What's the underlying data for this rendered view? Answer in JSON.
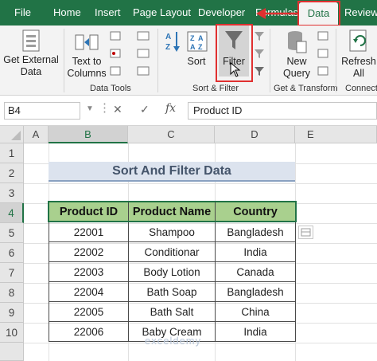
{
  "tabs": [
    "File",
    "Home",
    "Insert",
    "Page Layout",
    "Developer",
    "Formulas",
    "Data",
    "Review"
  ],
  "active_tab": "Data",
  "ribbon": {
    "get_external_data": [
      "Get External",
      "Data"
    ],
    "text_to_columns": [
      "Text to",
      "Columns"
    ],
    "sort": "Sort",
    "filter": "Filter",
    "new_query": [
      "New",
      "Query"
    ],
    "refresh_all": [
      "Refresh",
      "All"
    ],
    "groups": [
      "Data Tools",
      "Sort & Filter",
      "Get & Transform",
      "Connecti"
    ]
  },
  "formula_bar": {
    "name_box": "B4",
    "cancel": "✕",
    "enter": "✓",
    "fx": "fx",
    "value": "Product ID"
  },
  "columns": [
    "A",
    "B",
    "C",
    "D",
    "E"
  ],
  "rows": [
    "1",
    "2",
    "3",
    "4",
    "5",
    "6",
    "7",
    "8",
    "9",
    "10"
  ],
  "sheet": {
    "title": "Sort And Filter Data",
    "headers": [
      "Product ID",
      "Product Name",
      "Country"
    ],
    "data": [
      [
        "22001",
        "Shampoo",
        "Bangladesh"
      ],
      [
        "22002",
        "Conditionar",
        "India"
      ],
      [
        "22003",
        "Body Lotion",
        "Canada"
      ],
      [
        "22004",
        "Bath Soap",
        "Bangladesh"
      ],
      [
        "22005",
        "Bath Salt",
        "China"
      ],
      [
        "22006",
        "Baby Cream",
        "India"
      ]
    ]
  },
  "watermark": "exceldemy",
  "colors": {
    "excel_green": "#217346",
    "header_fill": "#a9d08e",
    "title_fill": "#dce3ee",
    "highlight": "#e03030"
  }
}
